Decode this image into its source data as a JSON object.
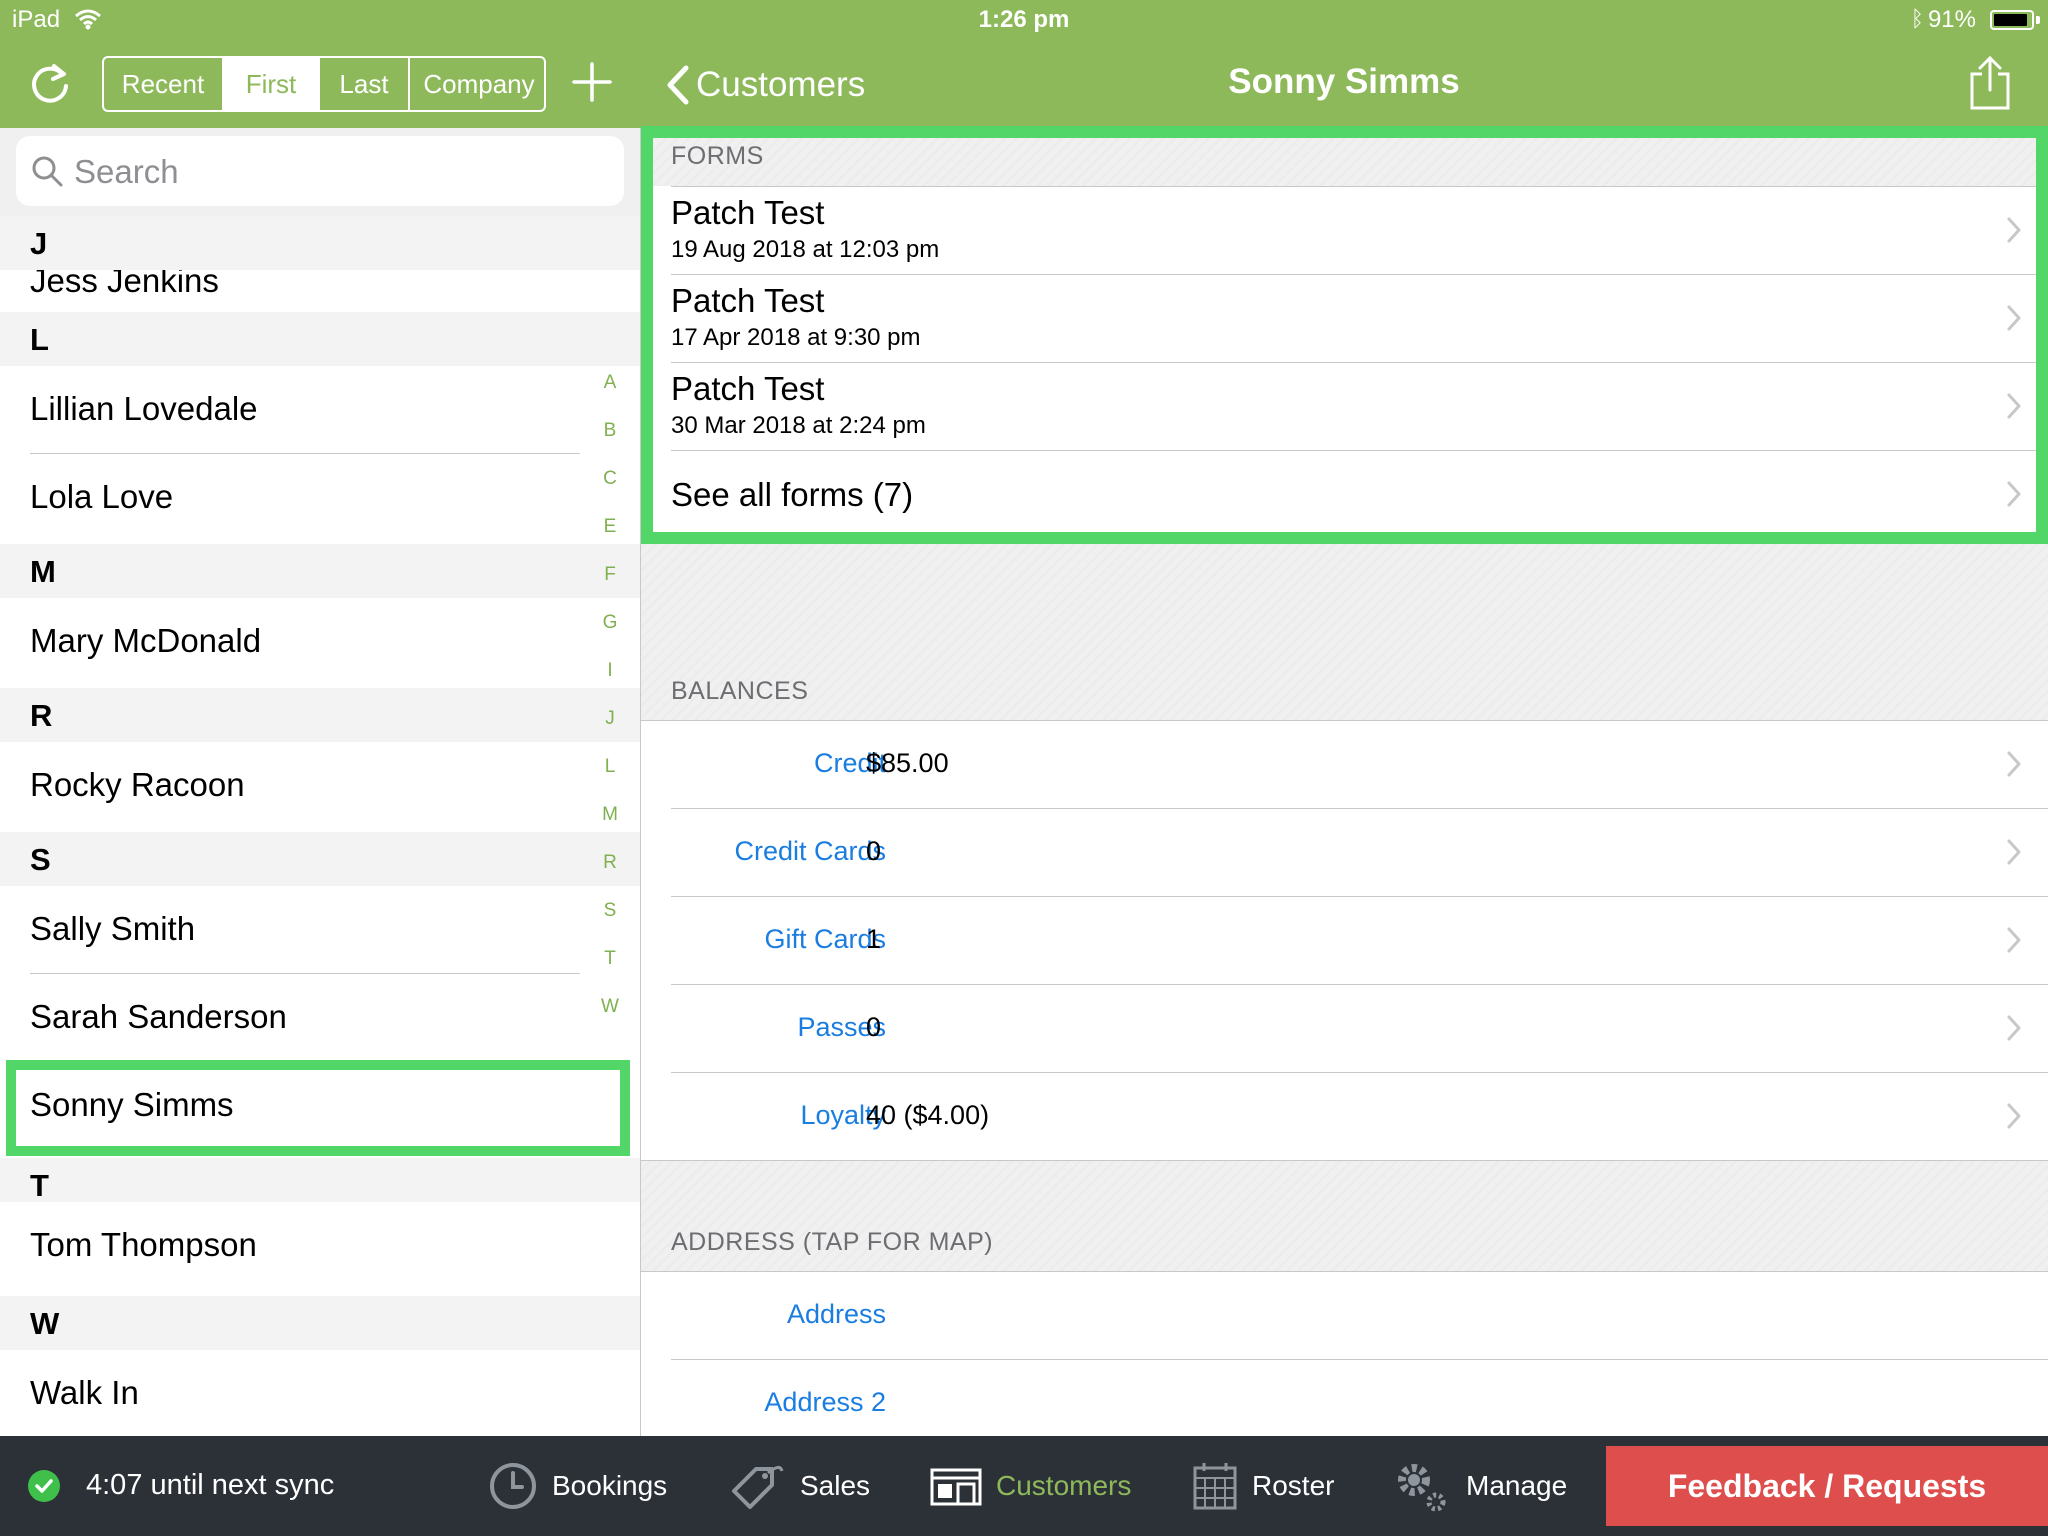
{
  "status_bar": {
    "device": "iPad",
    "time": "1:26 pm",
    "battery_pct": "91%",
    "battery_level": 0.91
  },
  "toolbar": {
    "segments": [
      {
        "label": "Recent",
        "active": false
      },
      {
        "label": "First",
        "active": true
      },
      {
        "label": "Last",
        "active": false
      },
      {
        "label": "Company",
        "active": false
      }
    ],
    "refresh_icon": "refresh-icon",
    "add_icon": "plus-icon"
  },
  "nav": {
    "back_label": "Customers",
    "title": "Sonny Simms",
    "share_icon": "share-icon"
  },
  "search": {
    "placeholder": "Search"
  },
  "customer_list": {
    "partial_name": "Jess Jenkins",
    "sections": [
      {
        "letter": "J"
      },
      {
        "letter": "L",
        "items": [
          "Lillian Lovedale",
          "Lola Love"
        ]
      },
      {
        "letter": "M",
        "items": [
          "Mary McDonald"
        ]
      },
      {
        "letter": "R",
        "items": [
          "Rocky Racoon"
        ]
      },
      {
        "letter": "S",
        "items": [
          "Sally Smith",
          "Sarah Sanderson",
          "Sonny Simms"
        ]
      },
      {
        "letter": "T",
        "items": [
          "Tom Thompson"
        ]
      },
      {
        "letter": "W",
        "items": [
          "Walk In"
        ]
      }
    ],
    "selected": "Sonny Simms",
    "index_letters": [
      "A",
      "B",
      "C",
      "E",
      "F",
      "G",
      "I",
      "J",
      "L",
      "M",
      "R",
      "S",
      "T",
      "W"
    ]
  },
  "forms": {
    "header": "FORMS",
    "items": [
      {
        "title": "Patch Test",
        "date": "19 Aug 2018 at 12:03 pm"
      },
      {
        "title": "Patch Test",
        "date": "17 Apr 2018 at 9:30 pm"
      },
      {
        "title": "Patch Test",
        "date": "30 Mar 2018 at 2:24 pm"
      }
    ],
    "see_all": "See all forms (7)"
  },
  "balances": {
    "header": "BALANCES",
    "rows": [
      {
        "label": "Credit",
        "value": "$85.00"
      },
      {
        "label": "Credit Cards",
        "value": "0"
      },
      {
        "label": "Gift Cards",
        "value": "1"
      },
      {
        "label": "Passes",
        "value": "0"
      },
      {
        "label": "Loyalty",
        "value": "40 ($4.00)"
      }
    ]
  },
  "address": {
    "header": "ADDRESS (TAP FOR MAP)",
    "rows": [
      {
        "label": "Address"
      },
      {
        "label": "Address 2"
      }
    ]
  },
  "tabbar": {
    "sync_text": "4:07 until next sync",
    "tabs": [
      {
        "label": "Bookings",
        "icon": "clock-icon",
        "active": false
      },
      {
        "label": "Sales",
        "icon": "tag-icon",
        "active": false
      },
      {
        "label": "Customers",
        "icon": "storefront-icon",
        "active": true
      },
      {
        "label": "Roster",
        "icon": "calendar-icon",
        "active": false
      },
      {
        "label": "Manage",
        "icon": "gears-icon",
        "active": false
      }
    ],
    "feedback_label": "Feedback / Requests"
  },
  "colors": {
    "brand_green": "#8db95b",
    "highlight_green": "#52d668",
    "link_blue": "#1a7de0",
    "feedback_red": "#de4e4c",
    "tabbar_bg": "#2c3138"
  }
}
